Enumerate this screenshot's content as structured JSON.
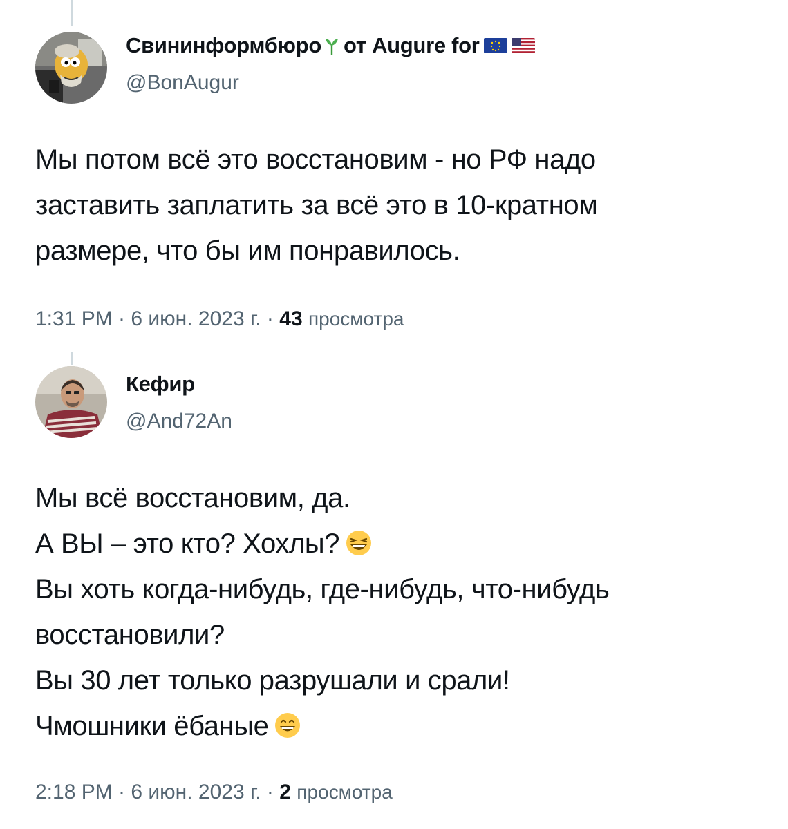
{
  "tweets": [
    {
      "display_name": "Свининформбюро",
      "name_suffix": "от Augure for",
      "handle": "@BonAugur",
      "body_lines": [
        "Мы потом всё это восстановим - но РФ надо",
        "заставить заплатить за всё это в 10-кратном",
        "размере, что бы им понравилось."
      ],
      "time": "1:31 PM · 6 июн. 2023 г. ·",
      "views_count": "43",
      "views_label": "просмотра",
      "icons": [
        "sprout-icon",
        "eu-flag-icon",
        "us-flag-icon"
      ]
    },
    {
      "display_name": "Кефир",
      "handle": "@And72An",
      "body_lines": [
        "Мы всё восстановим, да.",
        "А ВЫ – это кто? Хохлы?",
        "Вы хоть когда-нибудь, где-нибудь, что-нибудь",
        "восстановили?",
        "Вы 30 лет только разрушали и срали!",
        "Чмошники ёбаные"
      ],
      "time": "2:18 PM · 6 июн. 2023 г. ·",
      "views_count": "2",
      "views_label": "просмотра",
      "icons": [
        "laughing-emoji-icon",
        "grinning-emoji-icon"
      ]
    }
  ],
  "colors": {
    "text": "#0f1419",
    "secondary": "#536471",
    "thread_line": "#cfd9de",
    "emoji_yellow": "#ffcc4d"
  }
}
